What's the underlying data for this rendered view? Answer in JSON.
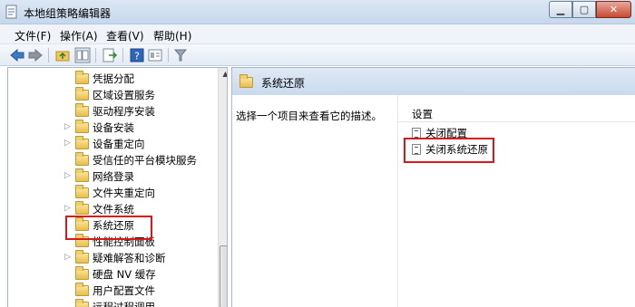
{
  "window": {
    "title": "本地组策略编辑器"
  },
  "menu": [
    "文件(F)",
    "操作(A)",
    "查看(V)",
    "帮助(H)"
  ],
  "tree": {
    "items": [
      {
        "label": "凭据分配",
        "expandable": false
      },
      {
        "label": "区域设置服务",
        "expandable": false
      },
      {
        "label": "驱动程序安装",
        "expandable": false
      },
      {
        "label": "设备安装",
        "expandable": true
      },
      {
        "label": "设备重定向",
        "expandable": true
      },
      {
        "label": "受信任的平台模块服务",
        "expandable": false
      },
      {
        "label": "网络登录",
        "expandable": true
      },
      {
        "label": "文件夹重定向",
        "expandable": false
      },
      {
        "label": "文件系统",
        "expandable": true
      },
      {
        "label": "系统还原",
        "expandable": false,
        "selected": true
      },
      {
        "label": "性能控制面板",
        "expandable": false
      },
      {
        "label": "疑难解答和诊断",
        "expandable": true
      },
      {
        "label": "硬盘 NV 缓存",
        "expandable": false
      },
      {
        "label": "用户配置文件",
        "expandable": false
      },
      {
        "label": "远程过程调用",
        "expandable": false
      }
    ]
  },
  "content": {
    "title": "系统还原",
    "description": "选择一个项目来查看它的描述。",
    "column_header": "设置",
    "settings": [
      {
        "label": "关闭配置"
      },
      {
        "label": "关闭系统还原",
        "highlighted": true
      }
    ]
  },
  "colors": {
    "highlight": "#d7191c",
    "header": "#c9daee"
  }
}
